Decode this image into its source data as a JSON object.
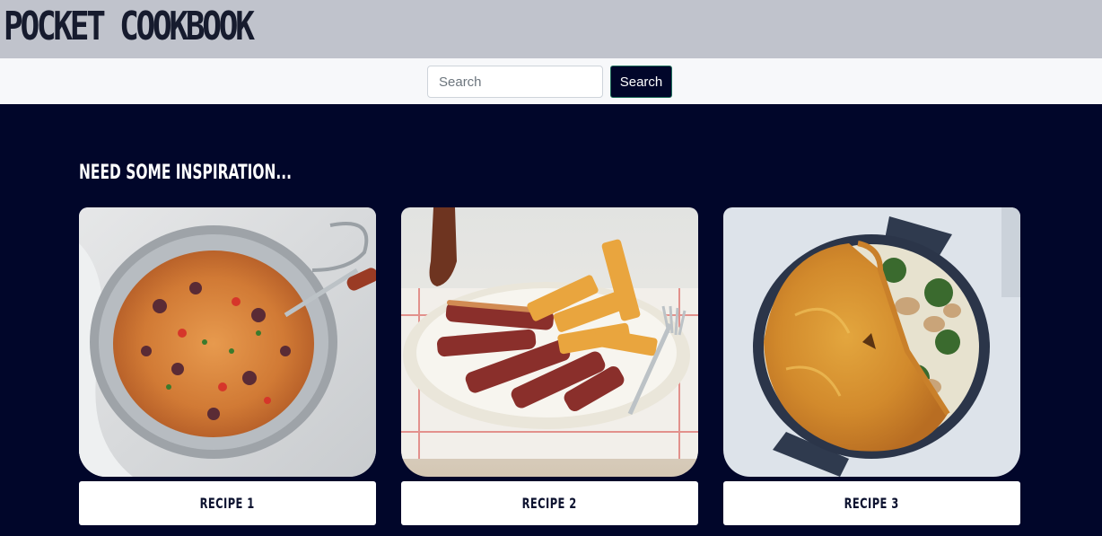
{
  "header": {
    "title": "POCKET COOKBOOK"
  },
  "search": {
    "placeholder": "Search",
    "value": "",
    "button_label": "Search"
  },
  "inspiration": {
    "title": "NEED SOME INSPIRATION...",
    "recipes": [
      {
        "label": "RECIPE 1",
        "image": "spaghetti-pan-image"
      },
      {
        "label": "RECIPE 2",
        "image": "steak-and-chips-image"
      },
      {
        "label": "RECIPE 3",
        "image": "chicken-pie-image"
      }
    ]
  },
  "colors": {
    "page_background": "#01062a",
    "header_background": "#c0c3cc",
    "search_band_background": "#f7f8fa",
    "button_background": "#01062a",
    "card_button_background": "#ffffff"
  }
}
